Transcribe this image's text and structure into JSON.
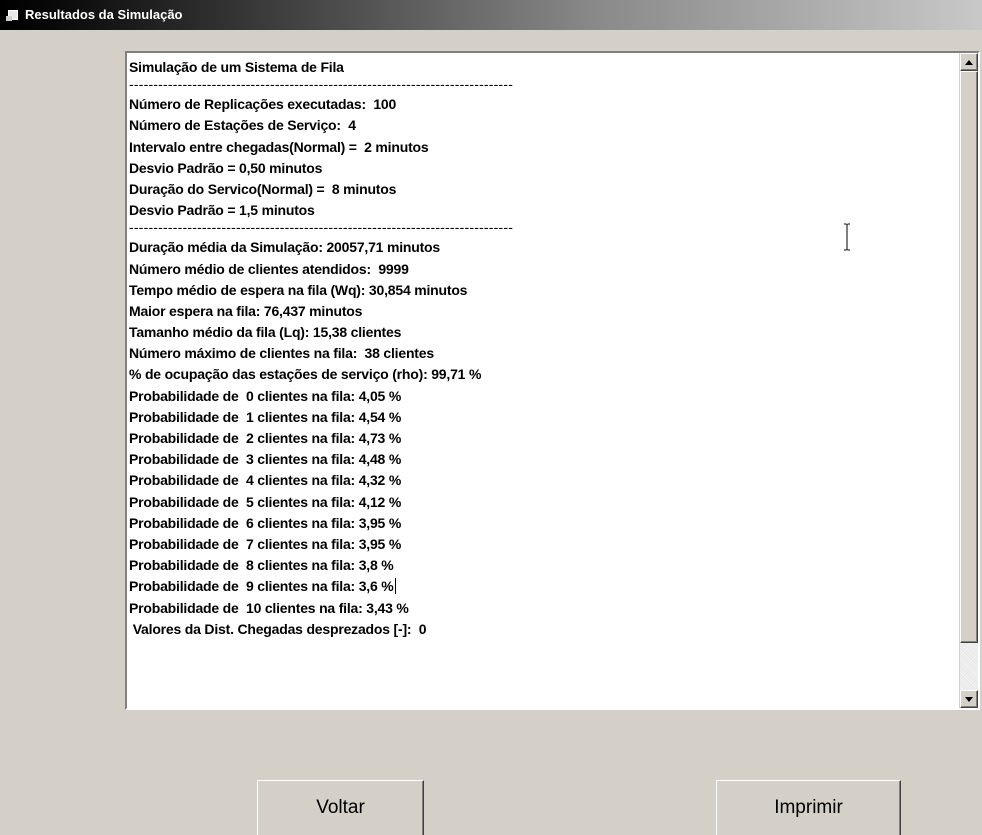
{
  "window": {
    "title": "Resultados da Simulação"
  },
  "report": {
    "lines": [
      "Simulação de um Sistema de Fila",
      "-------------------------------------------------------------------------------",
      "Número de Replicações executadas:  100",
      "Número de Estações de Serviço:  4",
      "Intervalo entre chegadas(Normal) =  2 minutos",
      "Desvio Padrão = 0,50 minutos",
      "Duração do Servico(Normal) =  8 minutos",
      "Desvio Padrão = 1,5 minutos",
      "-------------------------------------------------------------------------------",
      "Duração média da Simulação: 20057,71 minutos",
      "Número médio de clientes atendidos:  9999",
      "Tempo médio de espera na fila (Wq): 30,854 minutos",
      "Maior espera na fila: 76,437 minutos",
      "Tamanho médio da fila (Lq): 15,38 clientes",
      "Número máximo de clientes na fila:  38 clientes",
      "% de ocupação das estações de serviço (rho): 99,71 %",
      "Probabilidade de  0 clientes na fila: 4,05 %",
      "Probabilidade de  1 clientes na fila: 4,54 %",
      "Probabilidade de  2 clientes na fila: 4,73 %",
      "Probabilidade de  3 clientes na fila: 4,48 %",
      "Probabilidade de  4 clientes na fila: 4,32 %",
      "Probabilidade de  5 clientes na fila: 4,12 %",
      "Probabilidade de  6 clientes na fila: 3,95 %",
      "Probabilidade de  7 clientes na fila: 3,95 %",
      "Probabilidade de  8 clientes na fila: 3,8 %",
      "Probabilidade de  9 clientes na fila: 3,6 %",
      "Probabilidade de  10 clientes na fila: 3,43 %",
      " Valores da Dist. Chegadas desprezados [-]:  0"
    ]
  },
  "buttons": {
    "back_label": "Voltar",
    "print_label": "Imprimir"
  },
  "colors": {
    "window_bg": "#d4d0c8",
    "text_area_bg": "#ffffff",
    "title_text": "#ffffff"
  }
}
